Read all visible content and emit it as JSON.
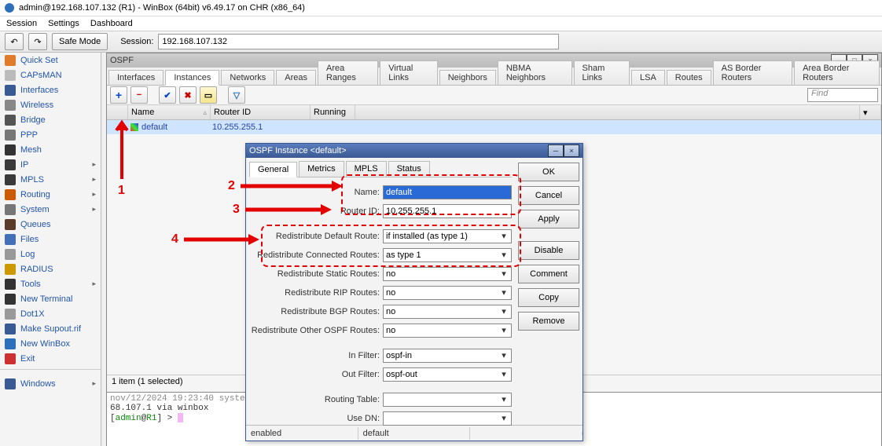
{
  "title": "admin@192.168.107.132 (R1) - WinBox (64bit) v6.49.17 on CHR (x86_64)",
  "menu": {
    "session": "Session",
    "settings": "Settings",
    "dashboard": "Dashboard"
  },
  "toolbar": {
    "undo": "↶",
    "redo": "↷",
    "safe_mode": "Safe Mode",
    "session_label": "Session:",
    "session_ip": "192.168.107.132"
  },
  "sidebar": {
    "items": [
      {
        "label": "Quick Set",
        "icon": "#e07b2c",
        "sub": false
      },
      {
        "label": "CAPsMAN",
        "icon": "#bbbbbb",
        "sub": false
      },
      {
        "label": "Interfaces",
        "icon": "#3a5a94",
        "sub": false
      },
      {
        "label": "Wireless",
        "icon": "#888888",
        "sub": false
      },
      {
        "label": "Bridge",
        "icon": "#555555",
        "sub": false
      },
      {
        "label": "PPP",
        "icon": "#777777",
        "sub": false
      },
      {
        "label": "Mesh",
        "icon": "#333333",
        "sub": false
      },
      {
        "label": "IP",
        "icon": "#3a3a3a",
        "sub": true
      },
      {
        "label": "MPLS",
        "icon": "#3a3a3a",
        "sub": true
      },
      {
        "label": "Routing",
        "icon": "#cc5a00",
        "sub": true
      },
      {
        "label": "System",
        "icon": "#777777",
        "sub": true
      },
      {
        "label": "Queues",
        "icon": "#5a3a2a",
        "sub": false
      },
      {
        "label": "Files",
        "icon": "#4470b8",
        "sub": false
      },
      {
        "label": "Log",
        "icon": "#999999",
        "sub": false
      },
      {
        "label": "RADIUS",
        "icon": "#cc9a00",
        "sub": false
      },
      {
        "label": "Tools",
        "icon": "#333333",
        "sub": true
      },
      {
        "label": "New Terminal",
        "icon": "#333333",
        "sub": false
      },
      {
        "label": "Dot1X",
        "icon": "#999999",
        "sub": false
      },
      {
        "label": "Make Supout.rif",
        "icon": "#3a5a94",
        "sub": false
      },
      {
        "label": "New WinBox",
        "icon": "#2c6fbb",
        "sub": false
      },
      {
        "label": "Exit",
        "icon": "#cc3030",
        "sub": false
      }
    ],
    "windows": "Windows"
  },
  "ospf": {
    "title": "OSPF",
    "tabs": [
      "Interfaces",
      "Instances",
      "Networks",
      "Areas",
      "Area Ranges",
      "Virtual Links",
      "Neighbors",
      "NBMA Neighbors",
      "Sham Links",
      "LSA",
      "Routes",
      "AS Border Routers",
      "Area Border Routers"
    ],
    "active_tab": 1,
    "find_placeholder": "Find",
    "cols": {
      "name": "Name",
      "router_id": "Router ID",
      "running": "Running"
    },
    "row": {
      "name": "default",
      "router_id": "10.255.255.1"
    },
    "status": "1 item (1 selected)"
  },
  "terminal": {
    "line1": "nov/12/2024  19:23:40  system",
    "ip": "68.107.1 via winbox",
    "prompt_user": "admin",
    "prompt_host": "R1",
    "prompt_tail": " > "
  },
  "dialog": {
    "title": "OSPF Instance <default>",
    "tabs": [
      "General",
      "Metrics",
      "MPLS",
      "Status"
    ],
    "fields": {
      "name_lbl": "Name:",
      "name_val": "default",
      "routerid_lbl": "Router ID:",
      "routerid_val": "10.255.255.1",
      "rdr_default_lbl": "Redistribute Default Route:",
      "rdr_default_val": "if installed (as type 1)",
      "rdr_conn_lbl": "Redistribute Connected Routes:",
      "rdr_conn_val": "as type 1",
      "rdr_static_lbl": "Redistribute Static Routes:",
      "rdr_static_val": "no",
      "rdr_rip_lbl": "Redistribute RIP Routes:",
      "rdr_rip_val": "no",
      "rdr_bgp_lbl": "Redistribute BGP Routes:",
      "rdr_bgp_val": "no",
      "rdr_other_lbl": "Redistribute Other OSPF Routes:",
      "rdr_other_val": "no",
      "infilter_lbl": "In Filter:",
      "infilter_val": "ospf-in",
      "outfilter_lbl": "Out Filter:",
      "outfilter_val": "ospf-out",
      "rtable_lbl": "Routing Table:",
      "rtable_val": "",
      "usedn_lbl": "Use DN:",
      "usedn_val": ""
    },
    "buttons": {
      "ok": "OK",
      "cancel": "Cancel",
      "apply": "Apply",
      "disable": "Disable",
      "comment": "Comment",
      "copy": "Copy",
      "remove": "Remove"
    },
    "status_left": "enabled",
    "status_right": "default"
  },
  "annotations": {
    "n1": "1",
    "n2": "2",
    "n3": "3",
    "n4": "4"
  }
}
